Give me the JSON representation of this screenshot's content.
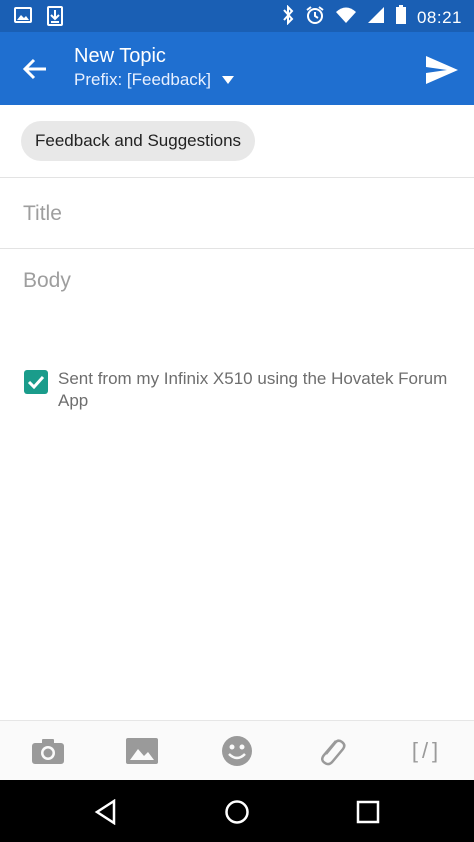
{
  "status_bar": {
    "time": "08:21",
    "icons": [
      "image-notification-icon",
      "download-notification-icon",
      "bluetooth-icon",
      "alarm-icon",
      "wifi-icon",
      "signal-icon",
      "battery-icon"
    ]
  },
  "app_bar": {
    "title": "New Topic",
    "prefix_label": "Prefix: [Feedback]",
    "colors": {
      "bar": "#1f6fd0",
      "status": "#1a5fb4"
    }
  },
  "forum_chip": {
    "label": "Feedback and Suggestions"
  },
  "fields": {
    "title_placeholder": "Title",
    "title_value": "",
    "body_placeholder": "Body",
    "body_value": ""
  },
  "signature": {
    "checked": true,
    "text": "Sent from my Infinix X510 using the Hovatek Forum App",
    "checkbox_color": "#1a9c8b"
  },
  "toolbar": {
    "items": [
      "camera-icon",
      "image-icon",
      "emoji-icon",
      "attachment-icon"
    ],
    "bbcode_label": "[/]"
  },
  "navigation": {
    "items": [
      "back-nav-icon",
      "home-nav-icon",
      "recents-nav-icon"
    ]
  }
}
